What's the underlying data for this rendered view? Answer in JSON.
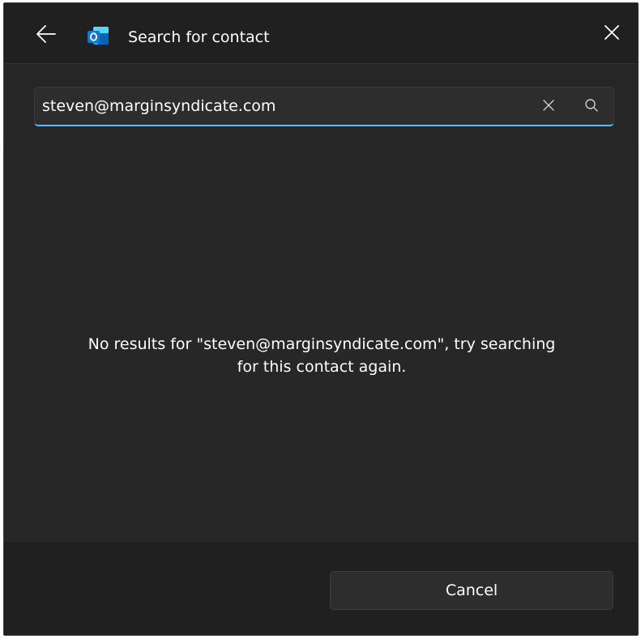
{
  "window": {
    "title": "Search for contact",
    "app_icon": "outlook-icon"
  },
  "titlebar": {
    "back_icon": "arrow-left-icon",
    "close_icon": "close-icon"
  },
  "search": {
    "value": "steven@marginsyndicate.com",
    "clear_icon": "clear-icon",
    "search_icon": "search-icon"
  },
  "results": {
    "message": "No results for \"steven@marginsyndicate.com\", try searching for this contact again."
  },
  "footer": {
    "cancel_label": "Cancel"
  },
  "colors": {
    "background": "#272727",
    "titlebar": "#202020",
    "accent": "#4cc2ff",
    "text": "#ffffff",
    "outlook_blue": "#0f78d4"
  }
}
